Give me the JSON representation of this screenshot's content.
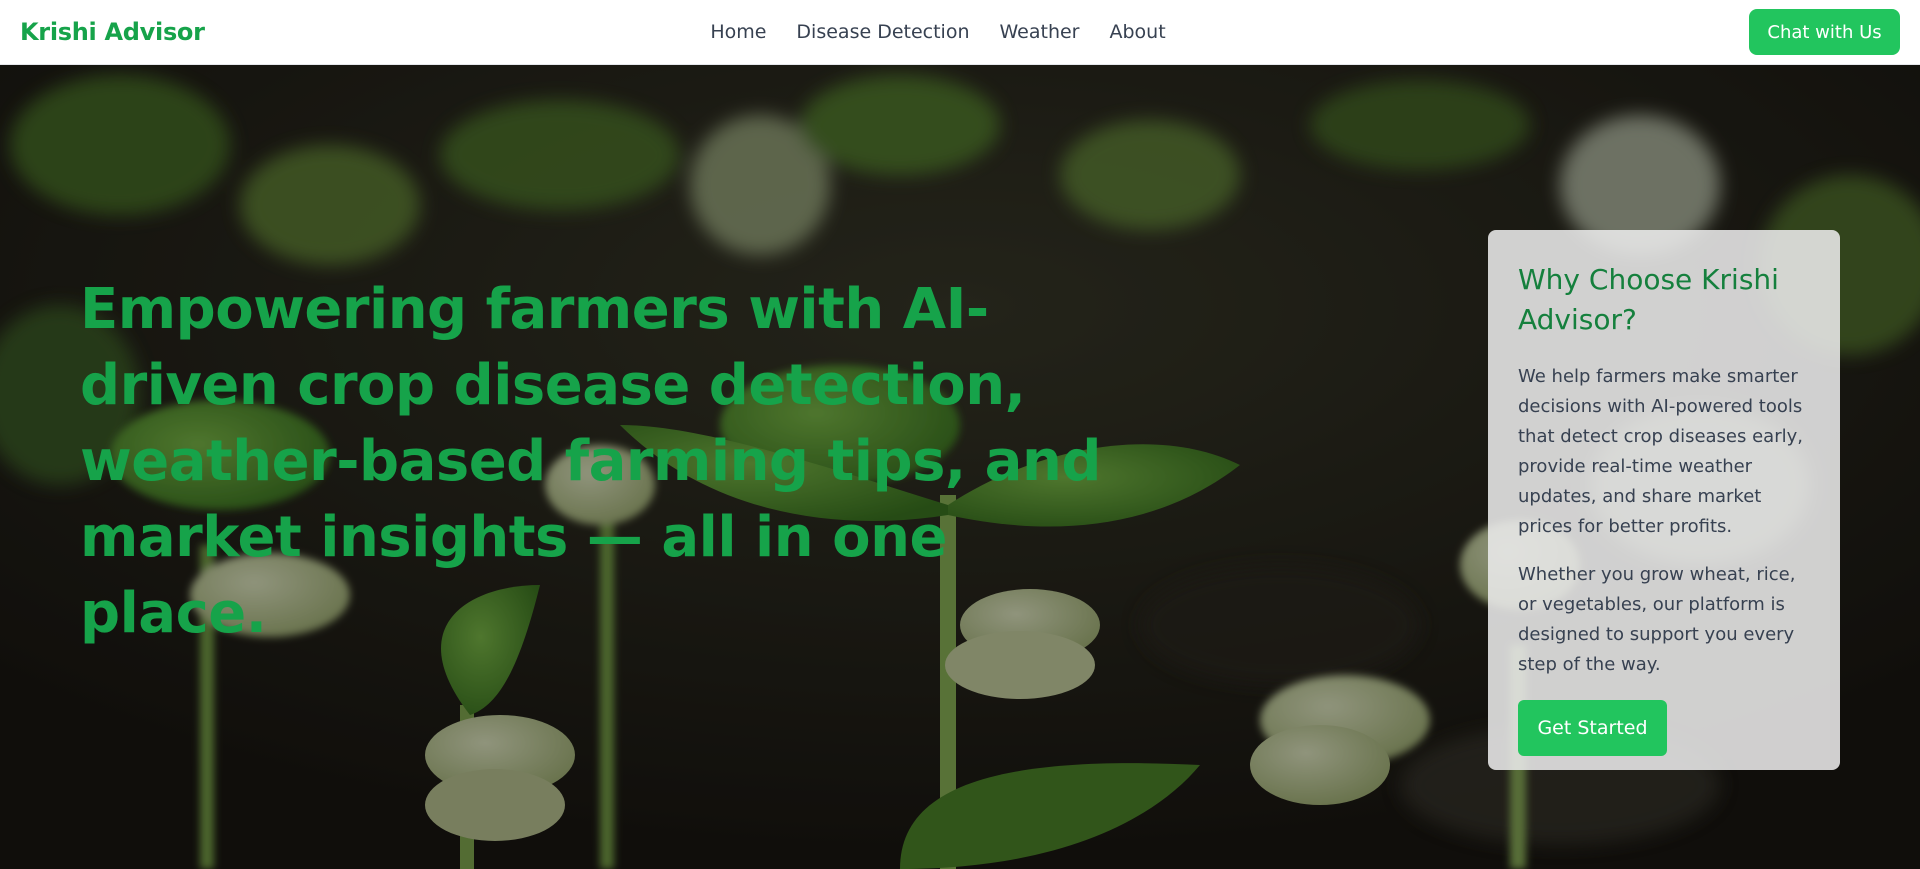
{
  "navbar": {
    "brand": "Krishi Advisor",
    "links": [
      "Home",
      "Disease Detection",
      "Weather",
      "About"
    ],
    "cta_label": "Chat with Us"
  },
  "hero": {
    "headline": "Empowering farmers with AI-driven crop disease detection, weather-based farming tips, and market insights — all in one place."
  },
  "card": {
    "title": "Why Choose Krishi Advisor?",
    "paragraph_1": "We help farmers make smarter decisions with AI-powered tools that detect crop diseases early, provide real-time weather updates, and share market prices for better profits.",
    "paragraph_2": "Whether you grow wheat, rice, or vegetables, our platform is designed to support you every step of the way.",
    "button_label": "Get Started"
  },
  "colors": {
    "brand_green": "#16a34a",
    "button_green": "#22c55e",
    "card_title_green": "#15803d",
    "nav_text": "#374151"
  },
  "icons": {
    "hero_background": "seedlings-photo"
  }
}
